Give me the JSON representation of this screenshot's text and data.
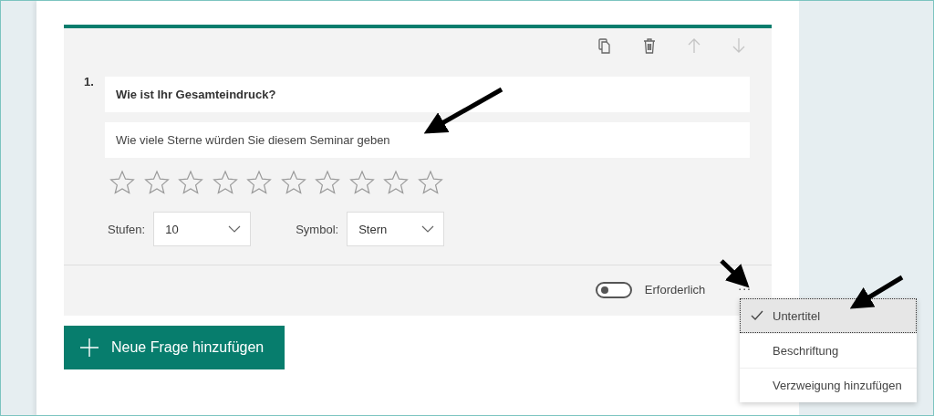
{
  "question_card": {
    "toolbar": [
      {
        "kind": "copy",
        "disabled": false
      },
      {
        "kind": "delete",
        "disabled": false
      },
      {
        "kind": "move_up",
        "disabled": true
      },
      {
        "kind": "move_down",
        "disabled": true
      }
    ],
    "number": "1.",
    "title": "Wie ist Ihr Gesamteindruck?",
    "subtitle": "Wie viele Sterne würden Sie diesem Seminar geben",
    "rating": {
      "stars": 0
    },
    "settings": [
      {
        "label": "Stufen:",
        "value": "10"
      },
      {
        "label": "Symbol:",
        "value": "Stern"
      }
    ],
    "required": {
      "label": "Erforderlich",
      "on": false
    },
    "more_button": "..."
  },
  "add_question_button": "Neue Frage hinzufügen",
  "more_menu": [
    {
      "label": "Untertitel",
      "checked": true,
      "selected": true
    },
    {
      "label": "Beschriftung",
      "checked": false,
      "selected": false
    },
    {
      "label": "Verzweigung hinzufügen",
      "checked": false,
      "selected": false
    }
  ]
}
